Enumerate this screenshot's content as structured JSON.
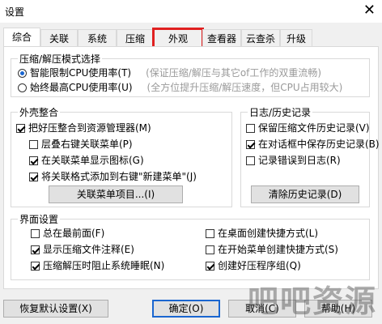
{
  "window": {
    "title": "设置",
    "close_symbol": "✕"
  },
  "tabs": [
    {
      "label": "综合"
    },
    {
      "label": "关联"
    },
    {
      "label": "系统"
    },
    {
      "label": "压缩"
    },
    {
      "label": "外观"
    },
    {
      "label": "查看器"
    },
    {
      "label": "云查杀"
    },
    {
      "label": "升级"
    }
  ],
  "mode_group": {
    "title": "压缩/解压模式选择",
    "options": [
      {
        "label": "智能限制CPU使用率(T)",
        "hint": "(保证压缩/解压与其它of工作的双重流畅)",
        "checked": true
      },
      {
        "label": "始终最高CPU使用率(U)",
        "hint": "(全方位提升压缩/解压速度，但CPU占用较大)",
        "checked": false
      }
    ]
  },
  "shell_group": {
    "title": "外壳整合",
    "items": [
      {
        "label": "把好压整合到资源管理器(M)",
        "checked": true
      },
      {
        "label": "层叠右键关联菜单(P)",
        "checked": false
      },
      {
        "label": "在关联菜单显示图标(G)",
        "checked": true
      },
      {
        "label": "将关联格式添加到右键\"新建菜单\"(J)",
        "checked": true
      }
    ],
    "button": "关联菜单项目...(I)"
  },
  "log_group": {
    "title": "日志/历史记录",
    "items": [
      {
        "label": "保留压缩文件历史记录(V)",
        "checked": false
      },
      {
        "label": "在对话框中保存历史记录(B)",
        "checked": true
      },
      {
        "label": "记录错误到日志(R)",
        "checked": false
      }
    ],
    "button": "清除历史记录(D)"
  },
  "ui_group": {
    "title": "界面设置",
    "left": [
      {
        "label": "总在最前面(F)",
        "checked": false
      },
      {
        "label": "显示压缩文件注释(E)",
        "checked": true
      },
      {
        "label": "压缩解压时阻止系统睡眠(N)",
        "checked": true
      }
    ],
    "right": [
      {
        "label": "在桌面创建快捷方式(L)",
        "checked": false
      },
      {
        "label": "在开始菜单创建快捷方式(S)",
        "checked": false
      },
      {
        "label": "创建好压程序组(Q)",
        "checked": true
      }
    ]
  },
  "footer": {
    "restore": "恢复默认设置(X)",
    "ok": "确定(O)",
    "cancel": "取消(C)",
    "help": "帮助(H)"
  },
  "watermark": "吧吧资源"
}
